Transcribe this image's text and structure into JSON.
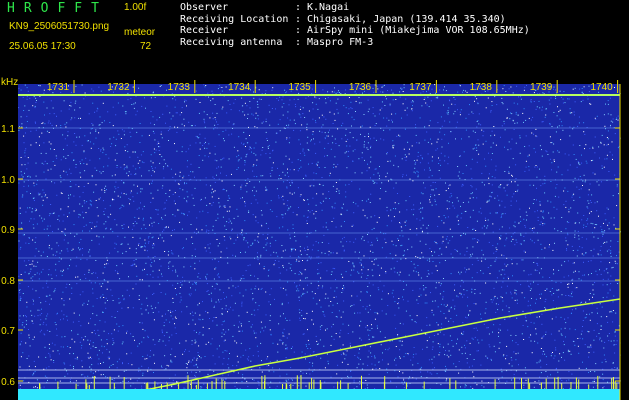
{
  "header": {
    "app_title": "HROFFT",
    "version": "1.00f",
    "file_name": "KN9_2506051730.png",
    "mode": "meteor",
    "timestamp": "25.06.05 17:30",
    "count": "72"
  },
  "info": [
    {
      "key": "Observer",
      "value": "K.Nagai"
    },
    {
      "key": "Receiving Location",
      "value": "Chigasaki, Japan (139.414 35.340)"
    },
    {
      "key": "Receiver",
      "value": "AirSpy mini (Miakejima VOR 108.65MHz)"
    },
    {
      "key": "Receiving antenna",
      "value": "Maspro FM-3"
    }
  ],
  "spectrogram": {
    "y_unit": "kHz",
    "y_ticks": [
      "1.1",
      "1.0",
      "0.9",
      "0.8",
      "0.7",
      "0.6"
    ],
    "x_ticks": [
      "1731",
      "1732",
      "1733",
      "1734",
      "1735",
      "1736",
      "1737",
      "1738",
      "1739",
      "1740"
    ],
    "colors": {
      "background": "#1a28a8",
      "axis": "#f0e000",
      "trace": "#c8ff40"
    }
  }
}
